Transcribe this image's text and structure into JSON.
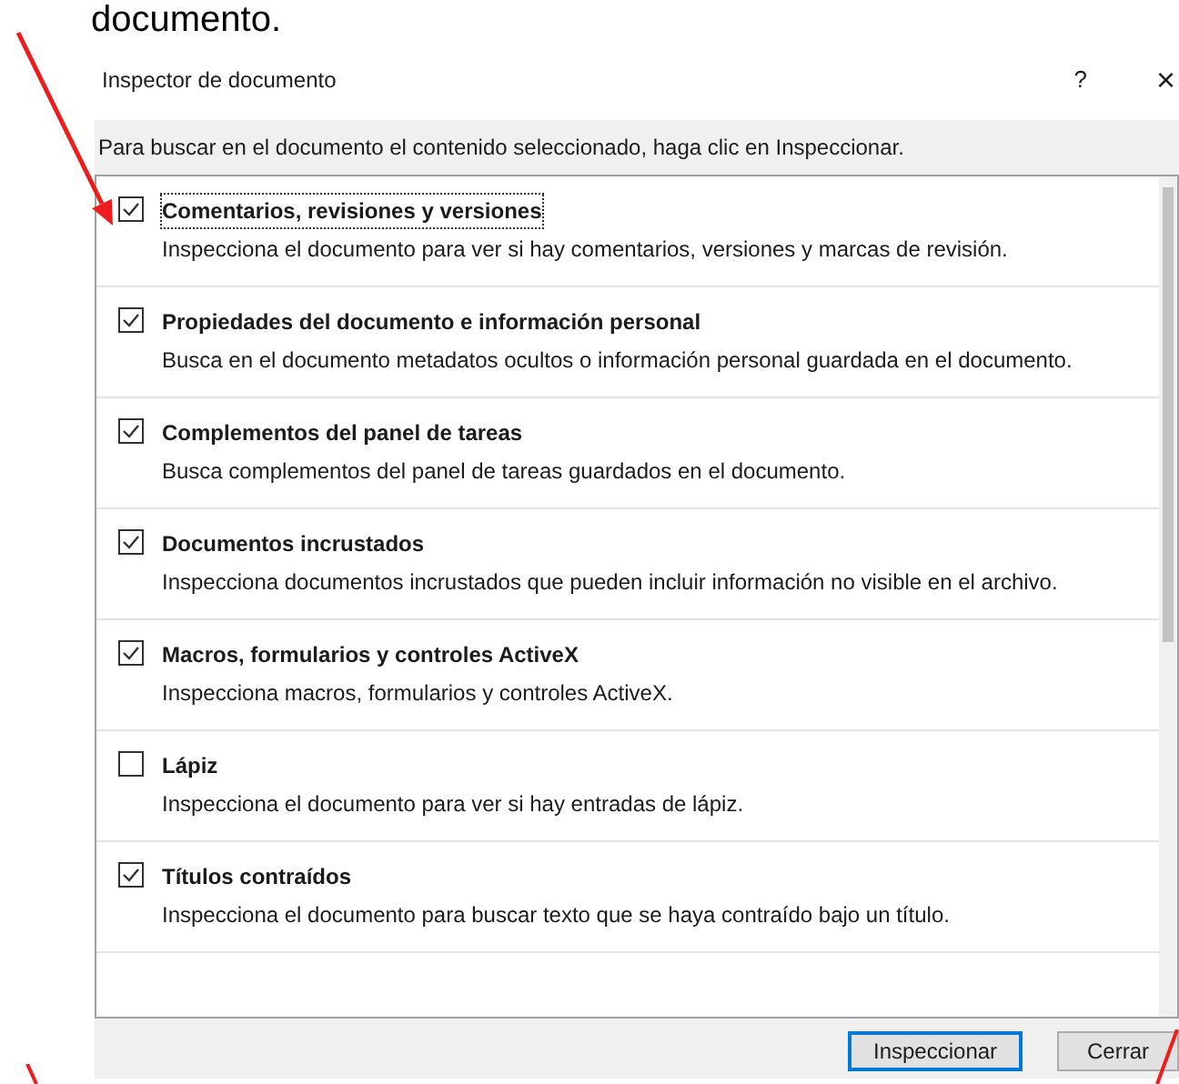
{
  "caption": "documento.",
  "dialog": {
    "title": "Inspector de documento",
    "help": "?",
    "close": "×",
    "instructions": "Para buscar en el documento el contenido seleccionado, haga clic en Inspeccionar.",
    "items": [
      {
        "title": "Comentarios, revisiones y versiones",
        "description": "Inspecciona el documento para ver si hay comentarios, versiones y marcas de revisión.",
        "checked": true,
        "focused": true
      },
      {
        "title": "Propiedades del documento e información personal",
        "description": "Busca en el documento metadatos ocultos o información personal guardada en el documento.",
        "checked": true,
        "focused": false
      },
      {
        "title": "Complementos del panel de tareas",
        "description": "Busca complementos del panel de tareas guardados en el documento.",
        "checked": true,
        "focused": false
      },
      {
        "title": "Documentos incrustados",
        "description": "Inspecciona documentos incrustados que pueden incluir información no visible en el archivo.",
        "checked": true,
        "focused": false
      },
      {
        "title": "Macros, formularios y controles ActiveX",
        "description": "Inspecciona macros, formularios y controles ActiveX.",
        "checked": true,
        "focused": false
      },
      {
        "title": "Lápiz",
        "description": "Inspecciona el documento para ver si hay entradas de lápiz.",
        "checked": false,
        "focused": false
      },
      {
        "title": "Títulos contraídos",
        "description": "Inspecciona el documento para buscar texto que se haya contraído bajo un título.",
        "checked": true,
        "focused": false
      }
    ],
    "buttons": [
      {
        "label": "Inspeccionar",
        "default": true
      },
      {
        "label": "Cerrar",
        "default": false
      }
    ]
  }
}
